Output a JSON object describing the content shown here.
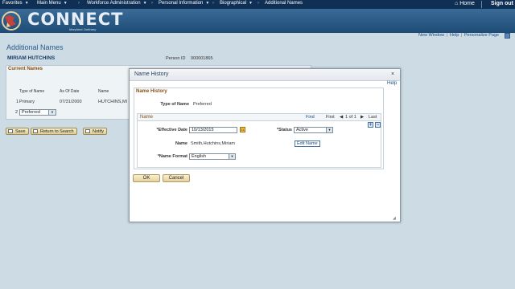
{
  "nav": {
    "items": [
      "Favorites",
      "Main Menu",
      "Workforce Administration",
      "Personal Information",
      "Biographical"
    ],
    "current": "Additional Names",
    "home": "Home",
    "sign_out": "Sign out"
  },
  "banner": {
    "brand": "CONNECT",
    "subtitle": "Maryland Judiciary"
  },
  "util_links": [
    "New Window",
    "Help",
    "Personalize Page"
  ],
  "page": {
    "title": "Additional Names",
    "employee_name": "MIRIAM HUTCHINS",
    "person_id_label": "Person ID",
    "person_id": "000001865"
  },
  "current_names": {
    "title": "Current Names",
    "headers": [
      "Type of Name",
      "As Of Date",
      "Name"
    ],
    "rows": [
      {
        "num": "1",
        "type": "Primary",
        "date": "07/31/2000",
        "name": "HUTCHINS,MI"
      },
      {
        "num": "2",
        "type": "Preferred"
      }
    ]
  },
  "page_buttons": [
    "Save",
    "Return to Search",
    "Notify"
  ],
  "modal": {
    "title": "Name History",
    "help": "Help",
    "section_title": "Name History",
    "type_of_name_label": "Type of Name",
    "type_of_name": "Preferred",
    "name_section": "Name",
    "nav": {
      "find": "Find",
      "first": "First",
      "range": "1 of 1",
      "last": "Last"
    },
    "effective_date_label": "*Effective Date",
    "effective_date": "10/13/2015",
    "status_label": "*Status",
    "status": "Active",
    "name_label": "Name",
    "name_value": "Smith,Hutchins,Miriam",
    "edit_name": "Edit Name",
    "name_format_label": "*Name Format",
    "name_format": "English",
    "ok": "OK",
    "cancel": "Cancel"
  },
  "colors": {
    "nav_bg": "#0f2f55",
    "banner": "#2c5d8a",
    "page_bg": "#ccdbe4",
    "section_title": "#8a4f10",
    "link": "#1a4d83"
  }
}
